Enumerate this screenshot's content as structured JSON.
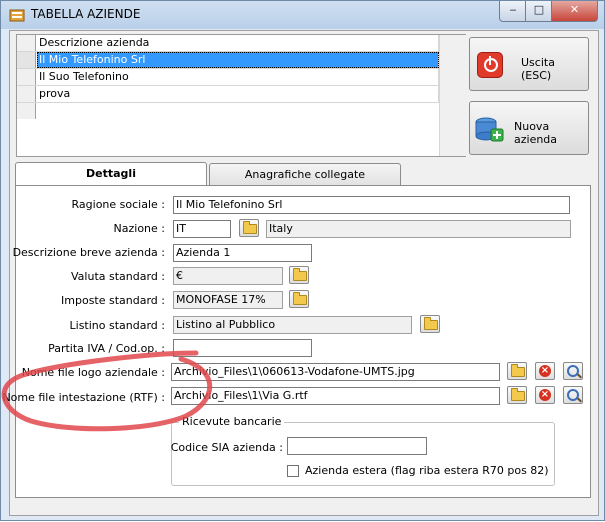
{
  "window": {
    "title": "TABELLA AZIENDE",
    "min_label": "‒",
    "max_label": "□",
    "close_label": "✕"
  },
  "grid": {
    "header": "Descrizione azienda",
    "rows": [
      "Il Mio Telefonino Srl",
      "Il Suo Telefonino",
      "prova"
    ]
  },
  "buttons": {
    "exit_label": "Uscita (ESC)",
    "new_company_label": "Nuova azienda"
  },
  "tabs": {
    "details": "Dettagli",
    "linked": "Anagrafiche collegate"
  },
  "form": {
    "ragione_sociale": {
      "label": "Ragione sociale :",
      "value": "Il Mio Telefonino Srl"
    },
    "nazione": {
      "label": "Nazione :",
      "code": "IT",
      "name": "Italy"
    },
    "descrizione_breve": {
      "label": "Descrizione breve azienda :",
      "value": "Azienda 1"
    },
    "valuta": {
      "label": "Valuta standard :",
      "value": "€"
    },
    "imposte": {
      "label": "Imposte standard :",
      "value": "MONOFASE 17%"
    },
    "listino": {
      "label": "Listino standard :",
      "value": "Listino al Pubblico"
    },
    "partita_iva": {
      "label": "Partita IVA / Cod.op. :",
      "value": ""
    },
    "logo": {
      "label": "Nome file logo aziendale :",
      "value": "Archivio_Files\\1\\060613-Vodafone-UMTS.jpg"
    },
    "intestazione": {
      "label": "Nome file intestazione (RTF) :",
      "value": "Archivio_Files\\1\\Via G.rtf"
    }
  },
  "ricevute": {
    "legend": "Ricevute bancarie",
    "sia_label": "Codice SIA azienda :",
    "sia_value": "",
    "estera_label": "Azienda estera (flag riba estera R70 pos 82)",
    "estera_checked": false
  },
  "colors": {
    "selection": "#3399ff",
    "annotation": "#e0474c",
    "exit_icon": "#e03a2a"
  },
  "icons": [
    "app-icon",
    "exit-icon",
    "database-add-icon",
    "folder-icon",
    "delete-icon",
    "search-icon"
  ]
}
